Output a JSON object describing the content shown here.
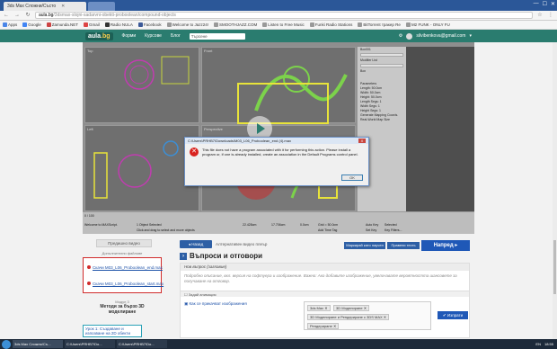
{
  "browser": {
    "tabs": [
      {
        "title": "3ds Max Сложни/Състо",
        "active": true
      },
      {
        "title": "",
        "active": false
      }
    ],
    "url_host": "aula.bg",
    "url_path": "/3dsmax-slojni-sadarvni-obekti-proboolean/compound-objects",
    "window_controls": [
      "—",
      "☐",
      "✕"
    ],
    "bookmarks": [
      "Apps",
      "Google",
      "Zamunda.NET",
      "Gmail",
      "Radio NULA",
      "Facebook",
      "Welcome to Jazz24!",
      "SMOOTHJAZZ.COM",
      "Listen to Free Music",
      "Funki Radio Stations",
      "BitTorrent тракер Re",
      "M2 FUNK - ONLY FU"
    ]
  },
  "site": {
    "logo_text": "aula",
    "logo_suffix": ".bg",
    "nav": [
      "Форми",
      "Курсове",
      "Блог"
    ],
    "search_placeholder": "Търсене",
    "user_email": "silvibenkova@gmail.com"
  },
  "video": {
    "viewport_labels": [
      "Top",
      "Front",
      "Left",
      "Perspective"
    ],
    "statusbar": {
      "objects_selected": "1 Object Selected",
      "hint": "Click and drag to select and move objects",
      "x": "22.428cm",
      "y": "17.706cm",
      "z": "0.0cm",
      "grid": "Grid = 50.0cm",
      "autokey": "Auto Key",
      "selected": "Selected",
      "setkey": "Set Key",
      "keyfilters": "Key Filters...",
      "add_time_tag": "Add Time Tag",
      "frames": "0 / 100",
      "welcome": "Welcome to MAXScript."
    },
    "command_panel": [
      "Box001",
      "Modifier List",
      "Box",
      "Parameters",
      "Length: 50.0cm",
      "Width: 50.0cm",
      "Height: 50.0cm",
      "Length Segs: 1",
      "Width Segs: 1",
      "Height Segs: 1",
      "Generate Mapping Coords.",
      "Real-World Map Size"
    ]
  },
  "dialog": {
    "title": "C:\\Users\\PRHB7\\Downloads\\M03_L06_Proboolean_end (4).max",
    "close": "X",
    "message": "This file does not have a program associated with it for performing this action. Please install a program or, if one is already installed, create an association in the Default Programs control panel.",
    "ok_label": "OK"
  },
  "sidebar": {
    "prev_button": "Предишно видео",
    "materials_label": "Допълнителни файлове",
    "materials": [
      "Скачи M03_L06_Proboolean_end.max",
      "Скачи M03_L06_Proboolean_start.max"
    ],
    "module_label": "Модул 3",
    "module_title": "Методи за бързо 3D моделиране",
    "lesson": "Урок 1: Създаване и изпозване на 2D обекти"
  },
  "main": {
    "back_button": "Назад",
    "alt_video": "Алтернативен видео плеър",
    "mark_button": "Маркирай като научен",
    "review_button": "Правени тесть",
    "next_button": "Напред",
    "qa_title": "Въпроси и отговори",
    "question_head": "Нов въпрос (заглавие)",
    "question_desc": "Подробно описание, вкл. версия на софтуера и изображение. Важно: Ако добавите изображение, увеличавате вероятността шансовете за получаване на отговор.",
    "toolbar_label": "Задай анимация",
    "how_link": "Как се прикачват изображения",
    "tags": [
      "3ds Max",
      "3D Моделиране",
      "3D Моделиране и Рендериране с 3DS MAX",
      "Рендериране"
    ],
    "send_button": "Изпрати"
  },
  "taskbar": {
    "tasks": [
      "3ds Max Сложни/Съ...",
      "C:\\Users\\PRHB7\\Do...",
      "C:\\Users\\PRHB7\\Do..."
    ],
    "lang": "EN",
    "time": "18:55"
  },
  "colors": {
    "site_green": "#2a7c6f",
    "brand_blue": "#1f58b7",
    "error_red": "#d9231f"
  }
}
